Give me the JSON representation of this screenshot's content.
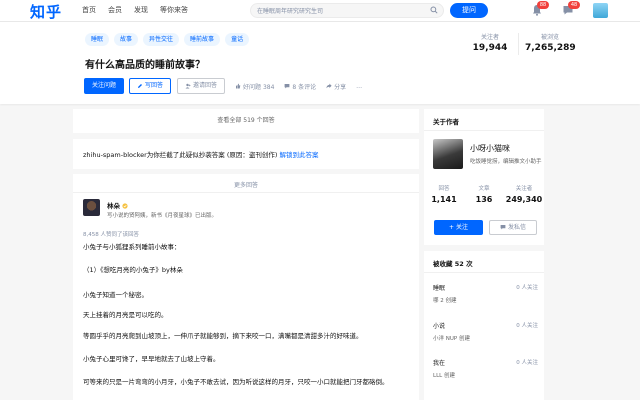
{
  "nav": {
    "logo": "知乎",
    "links": [
      "首页",
      "会员",
      "发现",
      "等你来答"
    ],
    "search_placeholder": "在睡眠周年研究研究生司",
    "ask_label": "提问",
    "badge_notifications": "88",
    "badge_messages": "48"
  },
  "question": {
    "tags": [
      "睡眠",
      "故事",
      "异性交往",
      "睡前故事",
      "童话"
    ],
    "title": "有什么高品质的睡前故事？",
    "follow_label": "关注问题",
    "write_answer_label": "写回答",
    "invite_label": "邀请回答",
    "upvote_label": "好问题 384",
    "comments_label": "8 条评论",
    "share_label": "分享",
    "more_label": "…",
    "followers_label": "关注者",
    "followers": "19,944",
    "views_label": "被浏览",
    "views": "7,265,289"
  },
  "main": {
    "view_all": "查看全部 519 个回答",
    "blocker_text": "zhihu-spam-blocker为你拦截了此疑似抄袭答案 (原因：盗刊创作) ",
    "blocker_link": "解锁到此答案",
    "more_answers": "更多回答",
    "answer": {
      "author_name": "林朵",
      "author_bio": "写小说的贤阿姨，新书《月夜星球》已出版。",
      "agree_text": "8,458 人赞同了该回答",
      "paragraphs": [
        "小兔子与小狐狸系列睡前小故事：",
        "（1）《想吃月亮的小兔子》by林朵",
        "小兔子知道一个秘密。",
        "天上挂着的月亮是可以吃的。",
        "等圆乎乎的月亮爬到山坡顶上，一伸爪子就能够到，摘下来咬一口，满嘴都是清甜多汁的好味道。",
        "小兔子心里可馋了，早早地就去了山坡上守着。",
        "可等来的只是一片弯弯的小月牙，小兔子不敢去试，因为听说这样的月牙，只咬一小口就能把门牙都硌倒。"
      ]
    }
  },
  "sidebar": {
    "about_title": "关于作者",
    "author_name": "小呀小猫咪",
    "author_bio": "吃饭睡觉捞，编辑推文小助手",
    "answers_label": "回答",
    "answers": "1,141",
    "articles_label": "文章",
    "articles": "136",
    "followers_label": "关注者",
    "followers": "249,340",
    "follow_label": "+ 关注",
    "message_label": "发私信",
    "collected_title": "被收藏 52 次",
    "favorites": [
      {
        "name": "睡眠",
        "follow": "0 人关注",
        "owner_prefix": "",
        "owner": "哪 2 创建"
      },
      {
        "name": "小说",
        "follow": "0 人关注",
        "owner_prefix": "",
        "owner": "小洋 NUP 创建"
      },
      {
        "name": "我在",
        "follow": "0 人关注",
        "owner_prefix": "",
        "owner": "LLL 创建"
      }
    ]
  },
  "colors": {
    "brand": "#0066ff",
    "badge": "#f1403c"
  }
}
